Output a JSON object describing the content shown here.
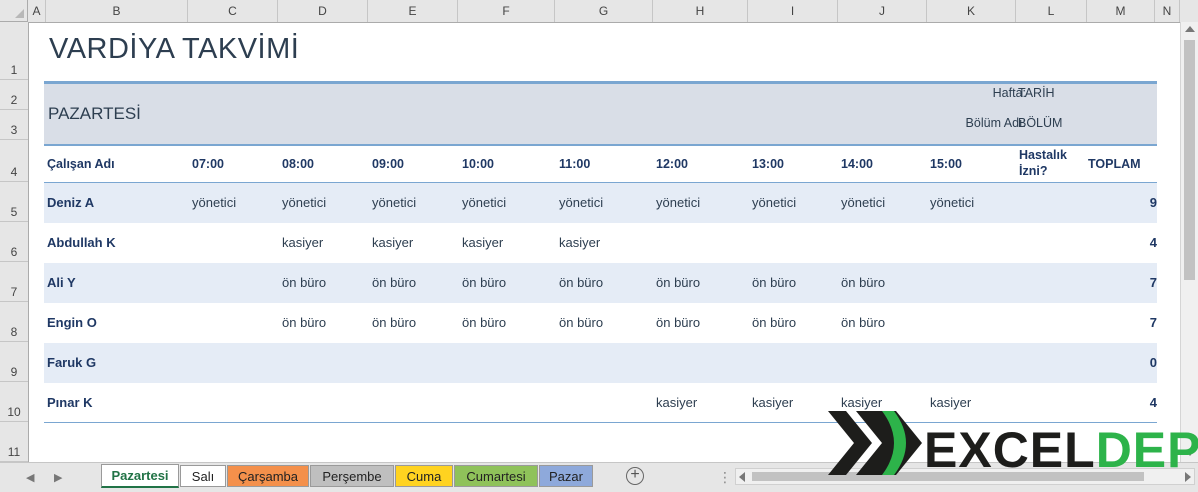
{
  "columns": [
    "A",
    "B",
    "C",
    "D",
    "E",
    "F",
    "G",
    "H",
    "I",
    "J",
    "K",
    "L",
    "M",
    "N"
  ],
  "rows": [
    "1",
    "2",
    "3",
    "4",
    "5",
    "6",
    "7",
    "8",
    "9",
    "10",
    "11"
  ],
  "title": "VARDİYA TAKVİMİ",
  "day": "PAZARTESİ",
  "meta": {
    "week_label": "Hafta:",
    "week_value": "TARİH",
    "dept_label": "Bölüm Adı:",
    "dept_value": "BÖLÜM"
  },
  "headers": {
    "employee": "Çalışan Adı",
    "times": [
      "07:00",
      "08:00",
      "09:00",
      "10:00",
      "11:00",
      "12:00",
      "13:00",
      "14:00",
      "15:00"
    ],
    "sick_line1": "Hastalık",
    "sick_line2": "İzni?",
    "total": "TOPLAM"
  },
  "employees": [
    {
      "name": "Deniz A",
      "cells": [
        "yönetici",
        "yönetici",
        "yönetici",
        "yönetici",
        "yönetici",
        "yönetici",
        "yönetici",
        "yönetici",
        "yönetici"
      ],
      "total": "9"
    },
    {
      "name": "Abdullah K",
      "cells": [
        "",
        "kasiyer",
        "kasiyer",
        "kasiyer",
        "kasiyer",
        "",
        "",
        "",
        ""
      ],
      "total": "4"
    },
    {
      "name": "Ali Y",
      "cells": [
        "",
        "ön büro",
        "ön büro",
        "ön büro",
        "ön büro",
        "ön büro",
        "ön büro",
        "ön büro",
        ""
      ],
      "total": "7"
    },
    {
      "name": "Engin O",
      "cells": [
        "",
        "ön büro",
        "ön büro",
        "ön büro",
        "ön büro",
        "ön büro",
        "ön büro",
        "ön büro",
        ""
      ],
      "total": "7"
    },
    {
      "name": "Faruk G",
      "cells": [
        "",
        "",
        "",
        "",
        "",
        "",
        "",
        "",
        ""
      ],
      "total": "0"
    },
    {
      "name": "Pınar K",
      "cells": [
        "",
        "",
        "",
        "",
        "",
        "kasiyer",
        "kasiyer",
        "kasiyer",
        "kasiyer"
      ],
      "total": "4"
    }
  ],
  "sheet_tabs": [
    {
      "label": "Pazartesi",
      "color": "#ffffff",
      "active": true
    },
    {
      "label": "Salı",
      "color": "#ffffff",
      "active": false
    },
    {
      "label": "Çarşamba",
      "color": "#f4904b",
      "active": false
    },
    {
      "label": "Perşembe",
      "color": "#bfbfbf",
      "active": false
    },
    {
      "label": "Cuma",
      "color": "#ffd320",
      "active": false
    },
    {
      "label": "Cumartesi",
      "color": "#8fc25a",
      "active": false
    },
    {
      "label": "Pazar",
      "color": "#8ea9db",
      "active": false
    }
  ],
  "logo": {
    "text": "EXCELDEPO",
    "part1": "EXCEL",
    "part2": "DEPO",
    "color_dark": "#1d1d1b",
    "color_green": "#2db34a"
  },
  "icons": {
    "add_sheet": "plus-circle-icon",
    "scroll_left": "triangle-left-icon",
    "scroll_right": "triangle-right-icon"
  }
}
